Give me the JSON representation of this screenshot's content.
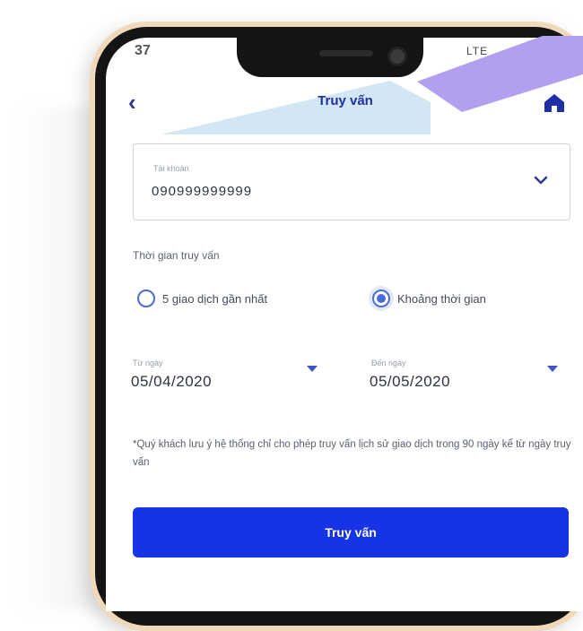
{
  "status_bar": {
    "time": "37",
    "indicators": "LTE"
  },
  "header": {
    "title": "Truy vấn",
    "back_icon": "chevron-left-icon",
    "home_icon": "home-icon"
  },
  "account": {
    "label": "Tài khoản",
    "value": "090999999999",
    "chevron_icon": "chevron-down-icon"
  },
  "query_time": {
    "label": "Thời gian truy vấn",
    "options": [
      {
        "label": "5 giao dịch gần nhất",
        "checked": false
      },
      {
        "label": "Khoảng thời gian",
        "checked": true
      }
    ]
  },
  "dates": {
    "from_label": "Từ ngày",
    "from_value": "05/04/2020",
    "to_label": "Đến ngày",
    "to_value": "05/05/2020"
  },
  "notice": "*Quý khách lưu ý hệ thống chỉ cho phép truy vấn lịch sử giao dịch trong 90 ngày kể từ ngày truy vấn",
  "submit_label": "Truy vấn",
  "colors": {
    "accent": "#1633e6",
    "title": "#1f2fa8",
    "radio": "#4a6cd4",
    "phone_frame": "#f0d8ba"
  }
}
